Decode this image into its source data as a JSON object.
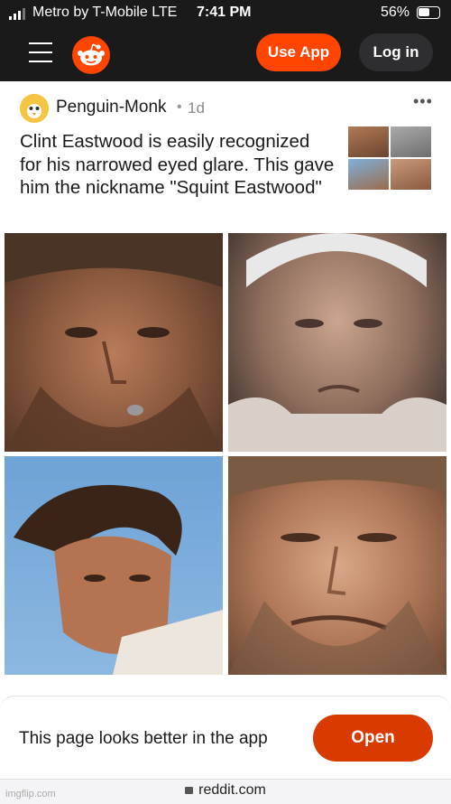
{
  "status": {
    "carrier": "Metro by T-Mobile  LTE",
    "time": "7:41 PM",
    "battery": "56%"
  },
  "nav": {
    "use_app": "Use App",
    "log_in": "Log in"
  },
  "post": {
    "author": "Penguin-Monk",
    "separator": "•",
    "age": "1d",
    "more": "•••",
    "title": "Clint Eastwood is easily recognized for his narrowed eyed glare. This gave him the nickname \"Squint Eastwood\""
  },
  "banner": {
    "text": "This page looks better in the app",
    "open": "Open"
  },
  "browser": {
    "url": "reddit.com",
    "watermark": "imgflip.com"
  }
}
